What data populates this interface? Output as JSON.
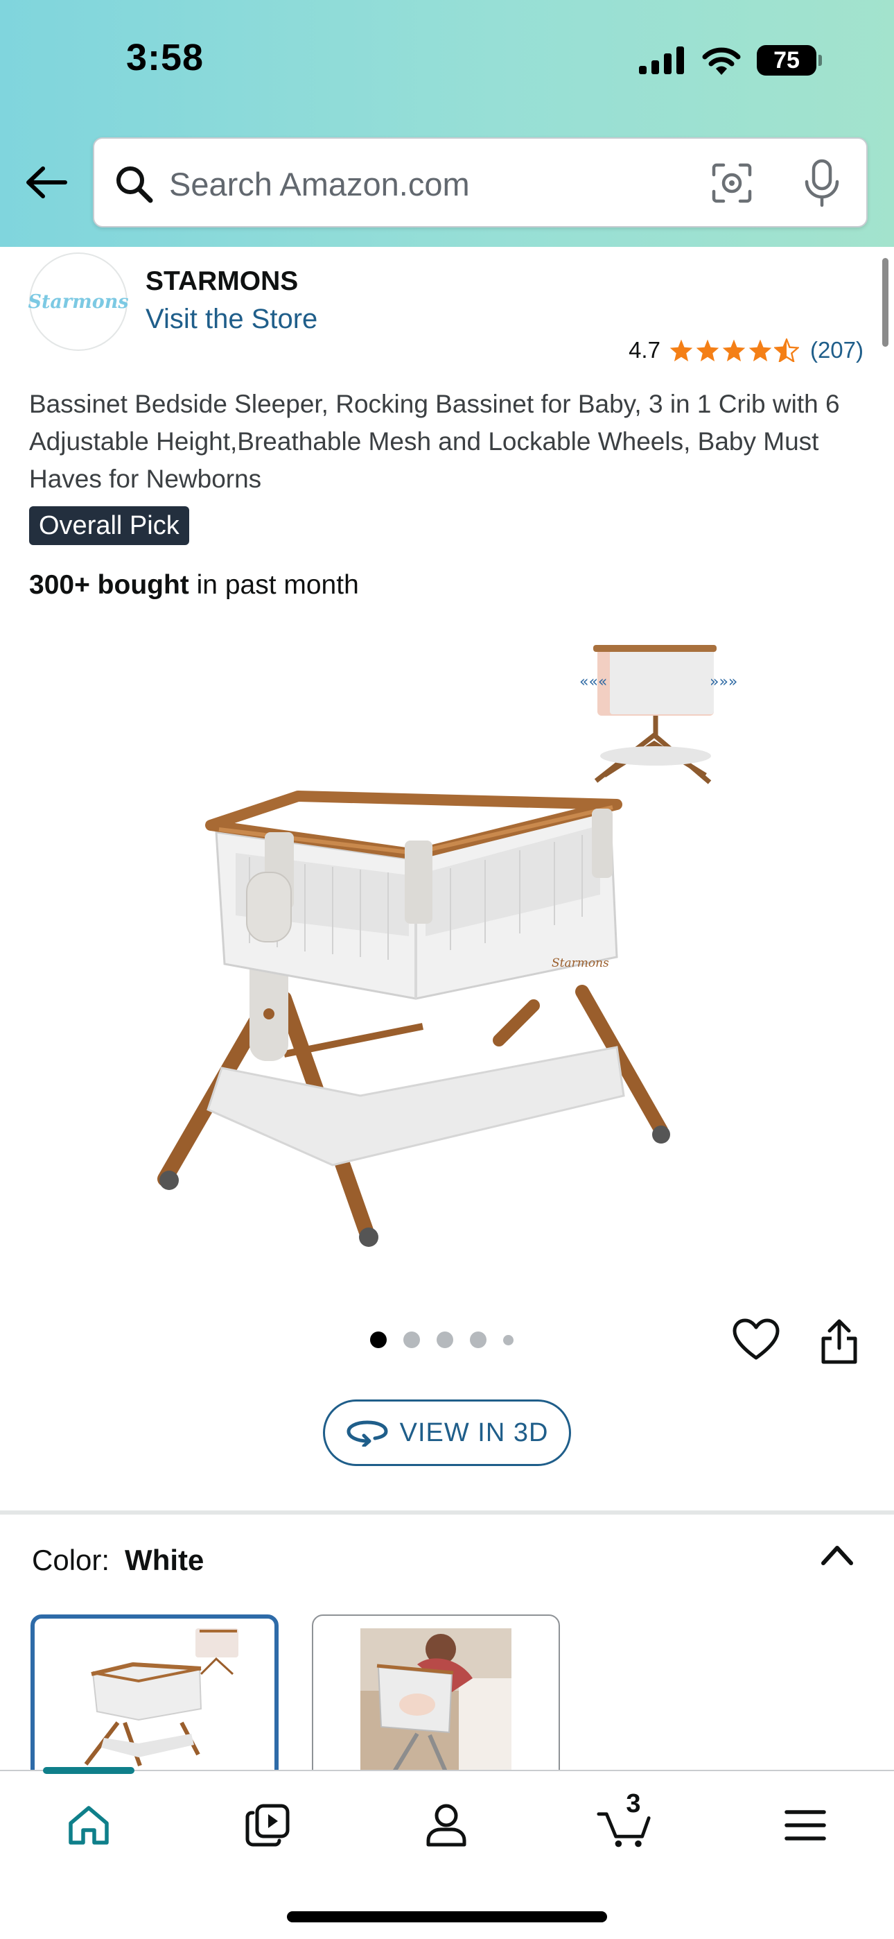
{
  "status_bar": {
    "time": "3:58",
    "battery": "75"
  },
  "header": {
    "search_placeholder": "Search Amazon.com"
  },
  "brand": {
    "logo_text": "Starmons",
    "name": "STARMONS",
    "visit_store": "Visit the Store"
  },
  "rating": {
    "value": "4.7",
    "stars": 4.5,
    "count": "(207)"
  },
  "product": {
    "title": "Bassinet Bedside Sleeper, Rocking Bassinet for Baby, 3 in 1 Crib with 6 Adjustable Height,Breathable Mesh and Lockable Wheels, Baby Must Haves for Newborns",
    "badge": "Overall Pick",
    "bought_bold": "300+ bought",
    "bought_rest": " in past month",
    "image_logo": "Starmons"
  },
  "gallery": {
    "image_count": 5,
    "active_index": 0,
    "view_3d_label": "VIEW IN 3D"
  },
  "variation": {
    "color_label": "Color:",
    "selected_color": "White",
    "swatches": [
      {
        "name": "White",
        "selected": true
      },
      {
        "name": "Lifestyle",
        "selected": false
      }
    ]
  },
  "bottom_nav": {
    "items": [
      "home",
      "video",
      "account",
      "cart",
      "menu"
    ],
    "active": "home",
    "cart_count": "3"
  },
  "colors": {
    "link_blue": "#1f5e8a",
    "star_orange": "#f47f16",
    "badge_bg": "#232f3e",
    "nav_active": "#0f7f8a",
    "header_gradient_start": "#80d5dd",
    "header_gradient_end": "#a3e3cd"
  }
}
